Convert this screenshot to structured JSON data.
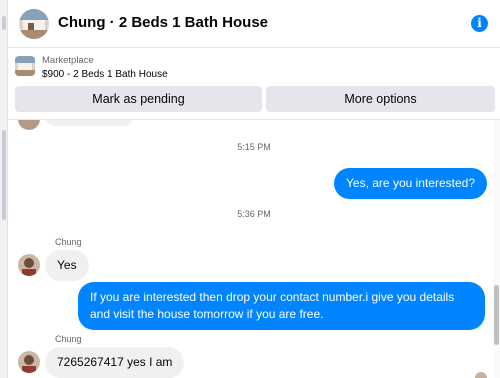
{
  "header": {
    "title": "Chung · 2 Beds 1 Bath House",
    "info_icon": "info-icon",
    "info_glyph": "i"
  },
  "marketplace": {
    "label": "Marketplace",
    "listing": "$900 - 2 Beds 1 Bath House",
    "buttons": {
      "pending": "Mark as pending",
      "more": "More options"
    }
  },
  "chat": {
    "timestamps": [
      "5:15 PM",
      "5:36 PM"
    ],
    "sender": "Chung",
    "messages": [
      {
        "direction": "out",
        "text": "Yes, are you interested?"
      },
      {
        "direction": "in",
        "text": "Yes"
      },
      {
        "direction": "out",
        "text": "If you are interested then drop your contact number.i give you details and visit the house tomorrow if you are free."
      },
      {
        "direction": "in",
        "text": "7265267417 yes I am"
      }
    ]
  },
  "colors": {
    "accent": "#0084ff",
    "incoming_bubble": "#f0f0f0",
    "button_bg": "#e4e6eb"
  }
}
